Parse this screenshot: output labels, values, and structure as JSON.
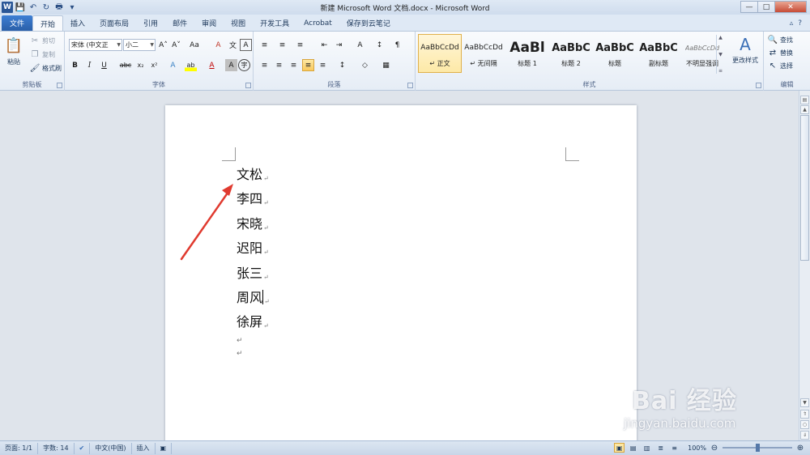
{
  "window": {
    "title": "新建 Microsoft Word 文档.docx - Microsoft Word",
    "app_icon": "W",
    "controls": {
      "minimize": "—",
      "maximize": "□",
      "close": "✕"
    }
  },
  "qat": {
    "save": "💾",
    "undo": "↶",
    "redo": "↻",
    "print": "🖶",
    "customize": "▾"
  },
  "tabs": {
    "file": "文件",
    "items": [
      "开始",
      "插入",
      "页面布局",
      "引用",
      "邮件",
      "审阅",
      "视图",
      "开发工具",
      "Acrobat",
      "保存到云笔记"
    ],
    "active_index": 0,
    "right": {
      "minimize_ribbon": "▵",
      "help": "?"
    }
  },
  "ribbon": {
    "clipboard": {
      "label": "剪贴板",
      "paste": "粘贴",
      "cut": "剪切",
      "copy": "复制",
      "format_painter": "格式刷"
    },
    "font": {
      "label": "字体",
      "font_name": "宋体 (中文正",
      "font_size": "小二",
      "bold": "B",
      "italic": "I",
      "underline": "U",
      "strike": "abc",
      "subscript": "x₂",
      "superscript": "x²",
      "grow": "A˄",
      "shrink": "A˅",
      "case": "Aa",
      "clear_format": "A",
      "phonetic": "文",
      "border_char": "A",
      "effects": "A",
      "highlight": "ab",
      "color": "A",
      "shading": "A",
      "enclose": "字"
    },
    "paragraph": {
      "label": "段落",
      "bullets": "≡",
      "numbering": "≡",
      "multilevel": "≡",
      "decrease_indent": "⇤",
      "increase_indent": "⇥",
      "chinese_layout": "A",
      "sort": "↕",
      "show_marks": "¶",
      "align_left": "≡",
      "align_center": "≡",
      "align_right": "≡",
      "justify": "≡",
      "distributed": "≡",
      "line_spacing": "↕",
      "shading": "◇",
      "borders": "▦"
    },
    "styles": {
      "label": "样式",
      "items": [
        {
          "preview": "AaBbCcDd",
          "name": "↵ 正文"
        },
        {
          "preview": "AaBbCcDd",
          "name": "↵ 无间隔"
        },
        {
          "preview": "AaBl",
          "name": "标题 1"
        },
        {
          "preview": "AaBbC",
          "name": "标题 2"
        },
        {
          "preview": "AaBbC",
          "name": "标题"
        },
        {
          "preview": "AaBbC",
          "name": "副标题"
        },
        {
          "preview": "AaBbCcDd",
          "name": "不明显强调"
        }
      ],
      "selected_index": 0,
      "change_styles": "更改样式"
    },
    "editing": {
      "label": "编辑",
      "find": "查找",
      "replace": "替换",
      "select": "选择"
    }
  },
  "document": {
    "paragraphs": [
      "文松",
      "李四",
      "宋晓",
      "迟阳",
      "张三",
      "周风",
      "徐屏"
    ],
    "caret_paragraph_index": 5,
    "paragraph_mark": "↵",
    "empty_paragraphs": 2
  },
  "watermark": {
    "main": "Bai 经验",
    "url": "jingyan.baidu.com"
  },
  "status": {
    "page": "页面: 1/1",
    "words": "字数: 14",
    "proofing": "✔",
    "language": "中文(中国)",
    "mode": "插入",
    "macro": "▣",
    "zoom": "100%",
    "zoom_out": "⊖",
    "zoom_in": "⊕"
  },
  "colors": {
    "accent": "#2b579a",
    "arrow": "#e03a2f",
    "file_tab": "#2a5fa8"
  }
}
